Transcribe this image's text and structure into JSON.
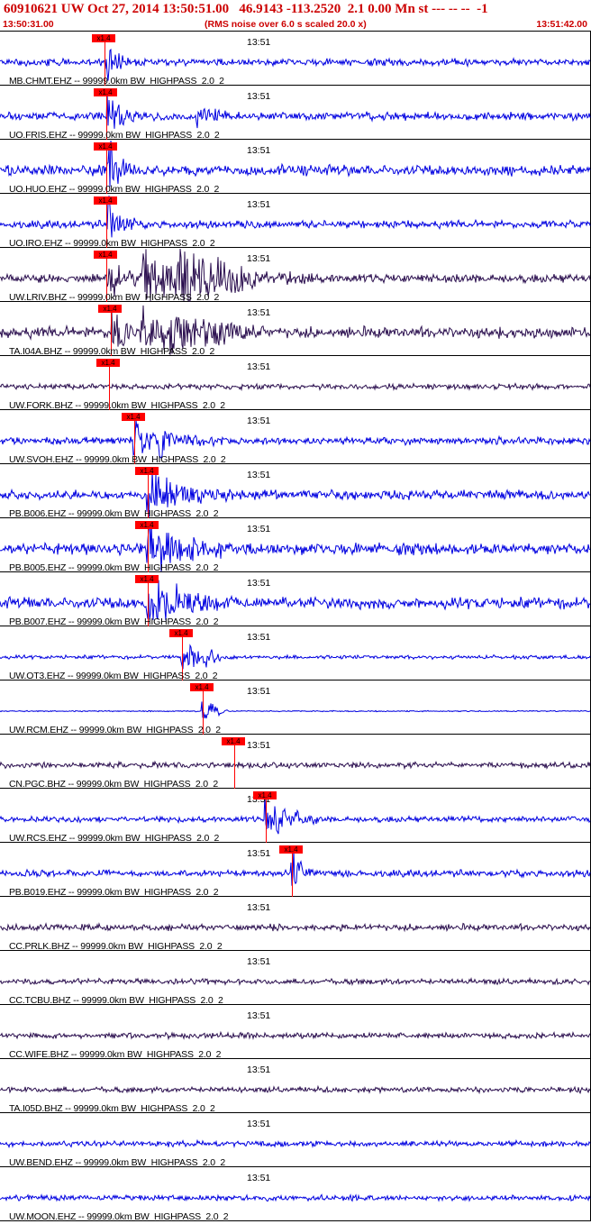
{
  "header": {
    "title": "60910621 UW Oct 27, 2014 13:50:51.00   46.9143 -113.2520  2.1 0.00 Mn st --- -- --  -1",
    "start_time": "13:50:31.00",
    "note": "(RMS noise over 6.0 s scaled 20.0 x)",
    "end_time": "13:51:42.00"
  },
  "colors": {
    "header_text": "#cc0000",
    "pick": "#ff0000",
    "blue": "#0000e0",
    "dark": "#2a0e4e"
  },
  "pick_label": "x1.4",
  "tick_label": "13:51",
  "traces": [
    {
      "label": "MB.CHMT.EHZ -- 99999.0km BW  HIGHPASS  2.0  2",
      "color": "blue",
      "pick": true,
      "pick_time": 1.1,
      "noise": 0.18,
      "events": [
        {
          "t": 0.5,
          "amp": 1.0,
          "dur": 0.6
        }
      ]
    },
    {
      "label": "UO.FRIS.EHZ -- 99999.0km BW  HIGHPASS  2.0  2",
      "color": "blue",
      "pick": true,
      "pick_time": 1.3,
      "noise": 0.22,
      "events": [
        {
          "t": 0.5,
          "amp": 1.0,
          "dur": 0.8
        },
        {
          "t": 11,
          "amp": 0.45,
          "dur": 1.2
        }
      ]
    },
    {
      "label": "UO.HUO.EHZ -- 99999.0km BW  HIGHPASS  2.0  2",
      "color": "blue",
      "pick": true,
      "pick_time": 1.3,
      "noise": 0.28,
      "events": [
        {
          "t": 0.5,
          "amp": 1.0,
          "dur": 0.8
        }
      ]
    },
    {
      "label": "UO.IRO.EHZ -- 99999.0km BW  HIGHPASS  2.0  2",
      "color": "blue",
      "pick": true,
      "pick_time": 1.3,
      "noise": 0.2,
      "events": [
        {
          "t": 0.5,
          "amp": 1.0,
          "dur": 0.8
        }
      ]
    },
    {
      "label": "UW.LRIV.BHZ -- 99999.0km BW  HIGHPASS  2.0  2",
      "color": "dark",
      "pick": true,
      "pick_time": 1.3,
      "noise": 0.22,
      "events": [
        {
          "t": 0.5,
          "amp": 0.7,
          "dur": 1.5
        },
        {
          "t": 4.5,
          "amp": 1.0,
          "dur": 3.5
        },
        {
          "t": 9,
          "amp": 1.0,
          "dur": 4
        }
      ]
    },
    {
      "label": "TA.I04A.BHZ -- 99999.0km BW  HIGHPASS  2.0  2",
      "color": "dark",
      "pick": true,
      "pick_time": 1.8,
      "noise": 0.3,
      "events": [
        {
          "t": 0.5,
          "amp": 0.8,
          "dur": 1
        },
        {
          "t": 4,
          "amp": 0.7,
          "dur": 3
        },
        {
          "t": 7.5,
          "amp": 0.75,
          "dur": 3
        }
      ]
    },
    {
      "label": "UW.FORK.BHZ -- 99999.0km BW  HIGHPASS  2.0  2",
      "color": "dark",
      "pick": true,
      "pick_time": 1.9,
      "noise": 0.15,
      "events": []
    },
    {
      "label": "UW.SVOH.EHZ -- 99999.0km BW  HIGHPASS  2.0  2",
      "color": "blue",
      "pick": true,
      "pick_time": 2.6,
      "noise": 0.2,
      "events": [
        {
          "t": 0.3,
          "amp": 0.8,
          "dur": 1.2
        },
        {
          "t": 3,
          "amp": 0.4,
          "dur": 2
        }
      ]
    },
    {
      "label": "PB.B006.EHZ -- 99999.0km BW  HIGHPASS  2.0  2",
      "color": "blue",
      "pick": true,
      "pick_time": 3.2,
      "noise": 0.25,
      "events": [
        {
          "t": 0.3,
          "amp": 1.0,
          "dur": 2.5
        }
      ]
    },
    {
      "label": "PB.B005.EHZ -- 99999.0km BW  HIGHPASS  2.0  2",
      "color": "blue",
      "pick": true,
      "pick_time": 3.3,
      "noise": 0.3,
      "events": [
        {
          "t": 0.3,
          "amp": 1.0,
          "dur": 2.5
        }
      ]
    },
    {
      "label": "PB.B007.EHZ -- 99999.0km BW  HIGHPASS  2.0  2",
      "color": "blue",
      "pick": true,
      "pick_time": 3.3,
      "noise": 0.3,
      "events": [
        {
          "t": 0.3,
          "amp": 1.0,
          "dur": 2.5
        }
      ]
    },
    {
      "label": "UW.OT3.EHZ -- 99999.0km BW  HIGHPASS  2.0  2",
      "color": "blue",
      "pick": true,
      "pick_time": 4.4,
      "noise": 0.1,
      "events": [
        {
          "t": 0.3,
          "amp": 0.55,
          "dur": 1.2
        },
        {
          "t": 3,
          "amp": 0.35,
          "dur": 0.8
        }
      ]
    },
    {
      "label": "UW.RCM.EHZ -- 99999.0km BW  HIGHPASS  2.0  2",
      "color": "blue",
      "pick": true,
      "pick_time": 5.8,
      "noise": 0.03,
      "events": [
        {
          "t": 0.3,
          "amp": 0.8,
          "dur": 0.7
        }
      ]
    },
    {
      "label": "CN.PGC.BHZ -- 99999.0km BW  HIGHPASS  2.0  2",
      "color": "dark",
      "pick": true,
      "pick_time": 6.3,
      "noise": 0.15,
      "events": []
    },
    {
      "label": "UW.RCS.EHZ -- 99999.0km BW  HIGHPASS  2.0  2",
      "color": "blue",
      "pick": true,
      "pick_time": 10.4,
      "noise": 0.15,
      "events": [
        {
          "t": 0.3,
          "amp": 1.0,
          "dur": 1.5
        }
      ]
    },
    {
      "label": "PB.B019.EHZ -- 99999.0km BW  HIGHPASS  2.0  2",
      "color": "blue",
      "pick": true,
      "pick_time": 11.6,
      "noise": 0.18,
      "events": [
        {
          "t": 0.3,
          "amp": 1.0,
          "dur": 0.6
        }
      ]
    },
    {
      "label": "CC.PRLK.BHZ -- 99999.0km BW  HIGHPASS  2.0  2",
      "color": "dark",
      "pick": false,
      "noise": 0.18,
      "events": []
    },
    {
      "label": "CC.TCBU.BHZ -- 99999.0km BW  HIGHPASS  2.0  2",
      "color": "dark",
      "pick": false,
      "noise": 0.15,
      "events": []
    },
    {
      "label": "CC.WIFE.BHZ -- 99999.0km BW  HIGHPASS  2.0  2",
      "color": "dark",
      "pick": false,
      "noise": 0.15,
      "events": []
    },
    {
      "label": "TA.I05D.BHZ -- 99999.0km BW  HIGHPASS  2.0  2",
      "color": "dark",
      "pick": false,
      "noise": 0.15,
      "events": []
    },
    {
      "label": "UW.BEND.EHZ -- 99999.0km BW  HIGHPASS  2.0  2",
      "color": "blue",
      "pick": false,
      "noise": 0.15,
      "events": []
    },
    {
      "label": "UW.MOON.EHZ -- 99999.0km BW  HIGHPASS  2.0  2",
      "color": "blue",
      "pick": false,
      "noise": 0.15,
      "events": []
    }
  ]
}
